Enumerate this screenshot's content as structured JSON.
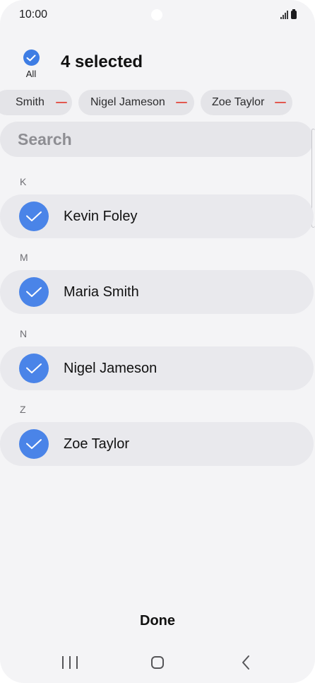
{
  "status_bar": {
    "time": "10:00",
    "icons": [
      "signal-icon",
      "battery-icon"
    ]
  },
  "header": {
    "all_label": "All",
    "all_checked": true,
    "selected_count_label": "4 selected"
  },
  "chips": [
    {
      "label": "Smith",
      "remove_icon": "minus-icon"
    },
    {
      "label": "Nigel Jameson",
      "remove_icon": "minus-icon"
    },
    {
      "label": "Zoe Taylor",
      "remove_icon": "minus-icon"
    }
  ],
  "search": {
    "placeholder": "Search",
    "value": ""
  },
  "sections": [
    {
      "letter": "K",
      "contacts": [
        {
          "name": "Kevin Foley",
          "selected": true
        }
      ]
    },
    {
      "letter": "M",
      "contacts": [
        {
          "name": "Maria Smith",
          "selected": true
        }
      ]
    },
    {
      "letter": "N",
      "contacts": [
        {
          "name": "Nigel Jameson",
          "selected": true
        }
      ]
    },
    {
      "letter": "Z",
      "contacts": [
        {
          "name": "Zoe Taylor",
          "selected": true
        }
      ]
    }
  ],
  "footer": {
    "done_label": "Done"
  },
  "nav_bar": {
    "icons": [
      "recents-icon",
      "home-icon",
      "back-icon"
    ]
  },
  "colors": {
    "accent": "#4a84e8",
    "chip_remove": "#e2584f",
    "background": "#f4f4f6"
  }
}
